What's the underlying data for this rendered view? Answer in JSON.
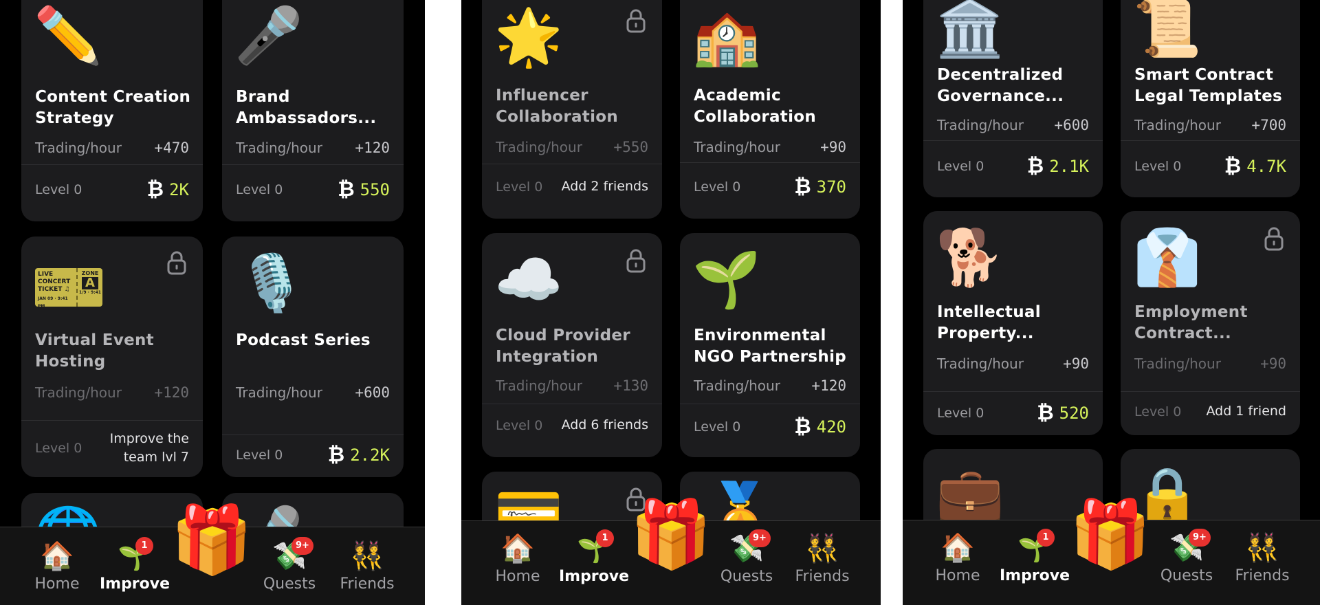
{
  "common": {
    "trading_label": "Trading/hour",
    "level_label": "Level 0",
    "coin_symbol": "₿",
    "colors": {
      "background": "#000000",
      "card": "#1c1c1e",
      "price": "#d6f25b",
      "badge": "#e8322f"
    }
  },
  "panel1": {
    "cards": [
      {
        "icon": "pencil-icon",
        "glyph": "✏️",
        "title": "Content Creation Strategy",
        "trading": "+470",
        "price": "2K"
      },
      {
        "icon": "microphone-icon",
        "glyph": "🎤",
        "title": "Brand Ambassadors...",
        "trading": "+120",
        "price": "550"
      },
      {
        "icon": "ticket-icon",
        "title": "Virtual Event Hosting",
        "trading": "+120",
        "requirement": "Improve the team lvl 7",
        "locked": true
      },
      {
        "icon": "studio-microphone-icon",
        "glyph": "🎙️",
        "title": "Podcast Series",
        "trading": "+600",
        "price": "2.2K"
      }
    ],
    "ticket": {
      "line1": "LIVE",
      "line2": "CONCERT",
      "line3": "TICKET ♫",
      "zone": "ZONE",
      "zone_letter": "A",
      "date": "JAN 09 · 9:41 PM",
      "seat": "1/9 · 9:41"
    }
  },
  "panel2": {
    "cards": [
      {
        "icon": "glowing-star-icon",
        "glyph": "🌟",
        "title": "Influencer Collaboration",
        "trading": "+550",
        "requirement": "Add 2 friends",
        "locked": true
      },
      {
        "icon": "school-icon",
        "glyph": "🏫",
        "title": "Academic Collaboration",
        "trading": "+90",
        "price": "370"
      },
      {
        "icon": "cloud-icon",
        "glyph": "☁️",
        "title": "Cloud Provider Integration",
        "trading": "+130",
        "requirement": "Add 6 friends",
        "locked": true
      },
      {
        "icon": "seedling-icon",
        "glyph": "🌱",
        "title": "Environmental NGO Partnership",
        "trading": "+120",
        "price": "420"
      }
    ]
  },
  "panel3": {
    "cards": [
      {
        "icon": "classical-building-icon",
        "glyph": "🏛️",
        "title": "Decentralized Governance...",
        "trading": "+600",
        "price": "2.1K"
      },
      {
        "icon": "scroll-icon",
        "glyph": "📜",
        "title": "Smart Contract Legal Templates",
        "trading": "+700",
        "price": "4.7K"
      },
      {
        "icon": "dog-icon",
        "glyph": "🐕",
        "title": "Intellectual Property...",
        "trading": "+90",
        "price": "520"
      },
      {
        "icon": "shirt-tie-icon",
        "glyph": "👔",
        "title": "Employment Contract...",
        "trading": "+90",
        "requirement": "Add 1 friend",
        "locked": true
      }
    ]
  },
  "partial_icons": {
    "globe": "🌐",
    "credit_card": "💳",
    "medal": "🏅",
    "briefcase": "💼",
    "padlock": "🔒"
  },
  "nav": {
    "home": {
      "label": "Home",
      "glyph": "🏠"
    },
    "improve": {
      "label": "Improve",
      "glyph": "🌱",
      "badge": "1"
    },
    "gift": {
      "glyph": "🎁"
    },
    "quests": {
      "label": "Quests",
      "glyph": "💸",
      "badge": "9+"
    },
    "friends": {
      "label": "Friends",
      "glyph": "👯"
    }
  }
}
